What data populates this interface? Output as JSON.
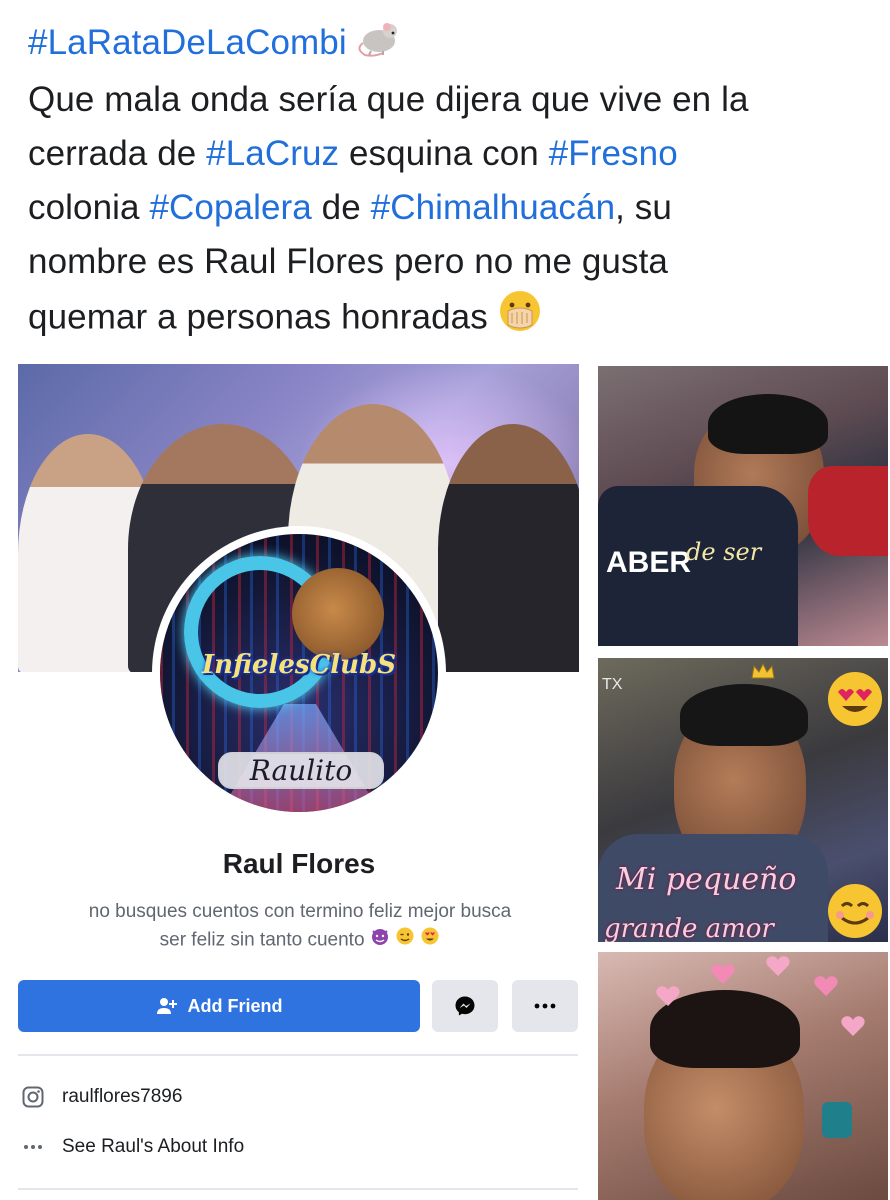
{
  "post": {
    "segments": [
      {
        "text": "#LaRataDeLaCombi",
        "kind": "hashtag"
      },
      {
        "text": " ",
        "kind": "text"
      },
      {
        "emoji": "rat-emoji"
      },
      {
        "break": true
      },
      {
        "text": "Que mala onda sería que dijera que vive en la",
        "kind": "text"
      },
      {
        "break": true
      },
      {
        "text": "cerrada de  ",
        "kind": "text"
      },
      {
        "text": "#LaCruz",
        "kind": "hashtag"
      },
      {
        "text": " esquina con ",
        "kind": "text"
      },
      {
        "text": "#Fresno",
        "kind": "hashtag"
      },
      {
        "break": true
      },
      {
        "text": "colonia ",
        "kind": "text"
      },
      {
        "text": "#Copalera",
        "kind": "hashtag"
      },
      {
        "text": " de ",
        "kind": "text"
      },
      {
        "text": "#Chimalhuacán",
        "kind": "hashtag"
      },
      {
        "text": ", su",
        "kind": "text"
      },
      {
        "break": true
      },
      {
        "text": "nombre es Raul Flores pero no me gusta",
        "kind": "text"
      },
      {
        "break": true
      },
      {
        "text": "quemar a personas honradas ",
        "kind": "text"
      },
      {
        "emoji": "hand-over-mouth-emoji"
      }
    ],
    "hashtag_color": "#216fdb"
  },
  "profile": {
    "avatar_brand": "InfielesClubS",
    "avatar_nick": "Raulito",
    "name": "Raul Flores",
    "bio_line1": "no busques cuentos con termino feliz mejor busca",
    "bio_line2": "ser feliz sin tanto cuento",
    "add_friend_label": "Add Friend",
    "instagram_handle": "raulflores7896",
    "about_label": "See Raul's About Info",
    "accent_color": "#2f73e0"
  },
  "photos": {
    "photo1_text": "de ser",
    "photo1_shirt": "ABER",
    "photo2_text": "Mi pequeño",
    "photo2_text2": "grande amor",
    "photo2_corner": "TX"
  }
}
